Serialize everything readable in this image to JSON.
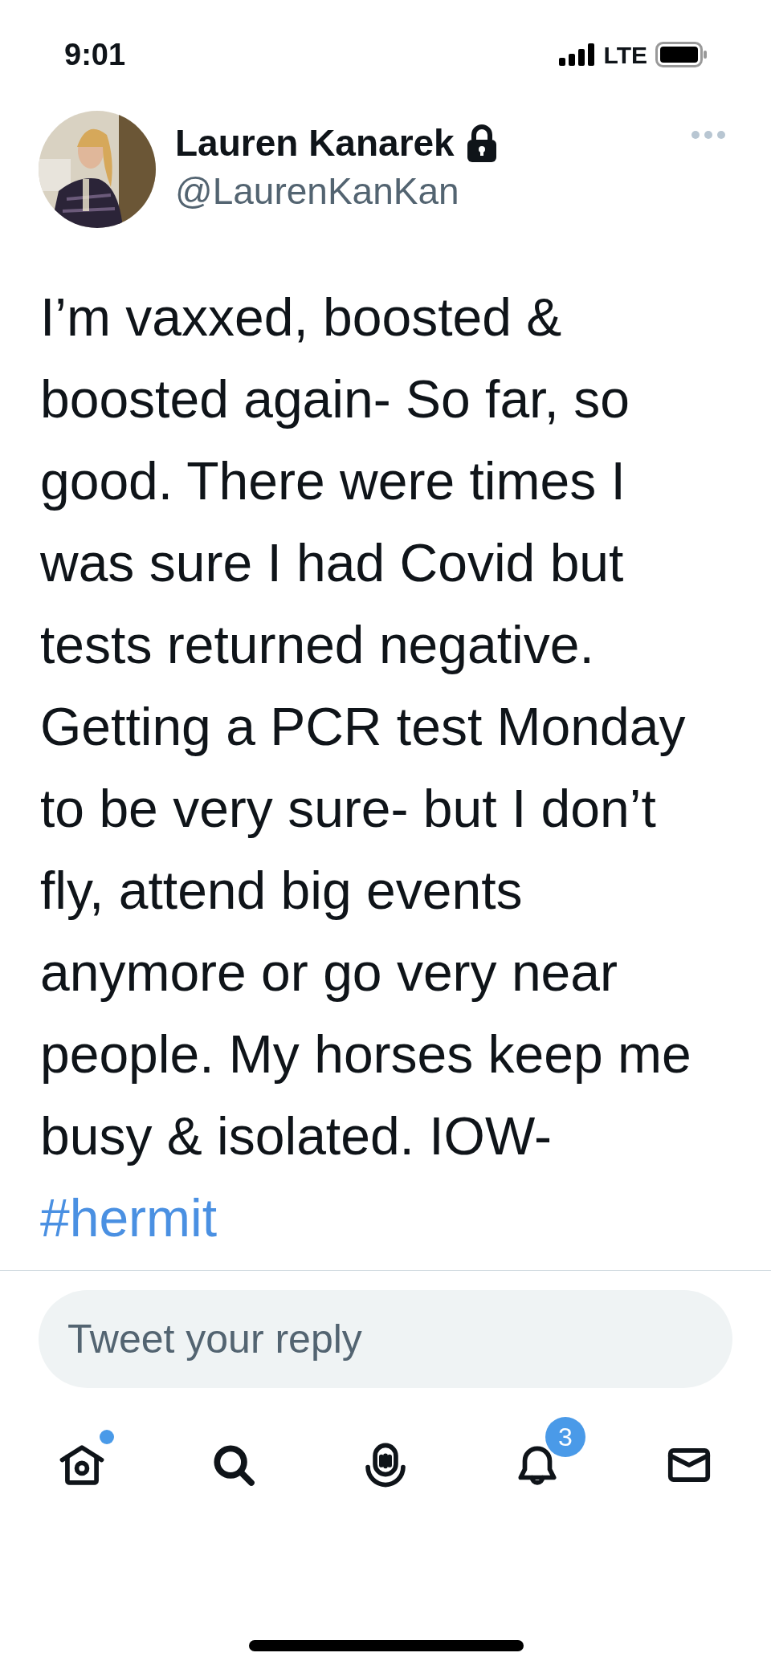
{
  "status_bar": {
    "time": "9:01",
    "network": "LTE"
  },
  "author": {
    "name": "Lauren Kanarek",
    "protected": true,
    "handle": "@LaurenKanKan"
  },
  "tweet": {
    "text": "I’m vaxxed, boosted & boosted again- So far, so good. There were times I was sure I had Covid but tests returned negative. Getting a PCR test Monday to be very sure- but I don’t fly, attend big events anymore or go very near people. My horses keep me busy & isolated. IOW-",
    "hashtag": "#hermit"
  },
  "reply": {
    "placeholder": "Tweet your reply"
  },
  "nav": [
    {
      "kind": "home",
      "dot": true
    },
    {
      "kind": "search",
      "dot": false
    },
    {
      "kind": "spaces",
      "dot": false
    },
    {
      "kind": "notifications",
      "badge": "3"
    },
    {
      "kind": "messages",
      "dot": false
    }
  ]
}
